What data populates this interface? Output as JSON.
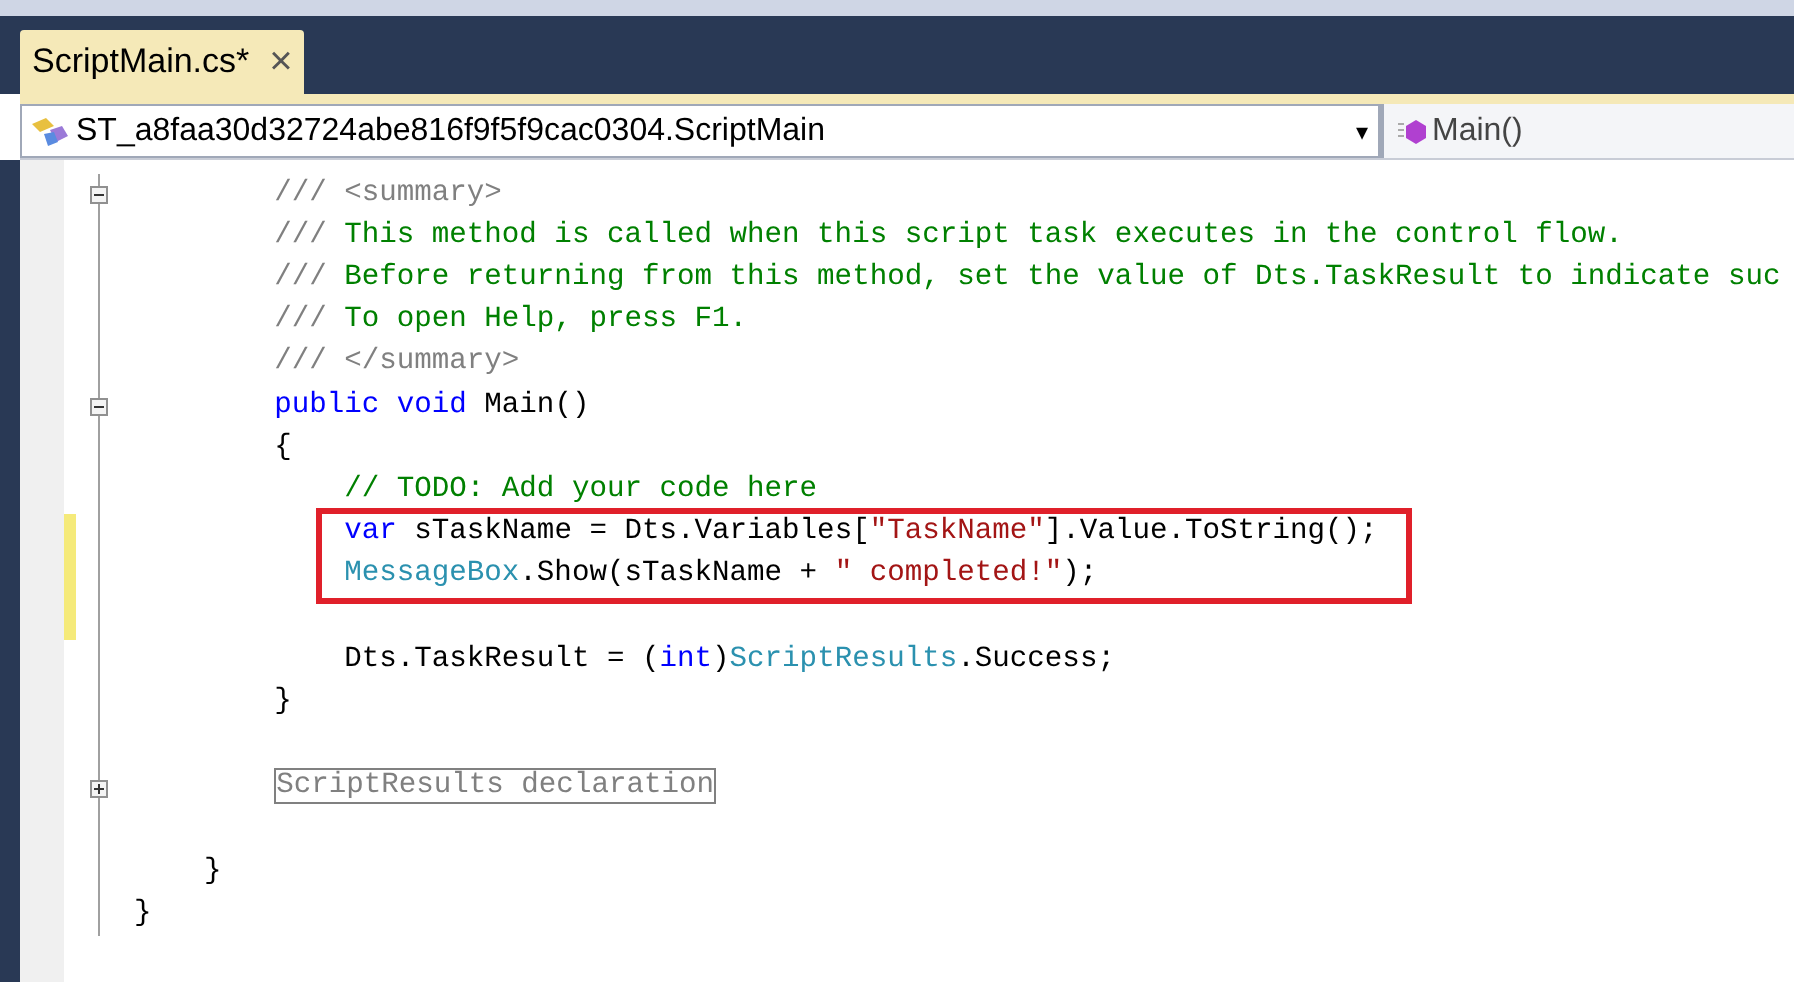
{
  "tabs": [
    {
      "label": "ScriptMain.cs*",
      "close": "×",
      "selected": true
    }
  ],
  "navigation": {
    "type_dropdown": {
      "value": "ST_a8faa30d32724abe816f9f5f9cac0304.ScriptMain",
      "caret": "▾"
    },
    "member_dropdown": {
      "value": "Main()"
    }
  },
  "code_lines": [
    {
      "expanded": true,
      "changed": false,
      "highlighted": false,
      "tokens": [
        {
          "kind": "doc_tag",
          "text": "        /// <summary>"
        }
      ]
    },
    {
      "changed": false,
      "highlighted": false,
      "tokens": [
        {
          "kind": "doc_tag",
          "text": "        /// "
        },
        {
          "kind": "comment",
          "text": "This method is called when this script task executes in the control flow."
        }
      ]
    },
    {
      "changed": false,
      "highlighted": false,
      "tokens": [
        {
          "kind": "doc_tag",
          "text": "        /// "
        },
        {
          "kind": "comment",
          "text": "Before returning from this method, set the value of Dts.TaskResult to indicate suc"
        }
      ]
    },
    {
      "changed": false,
      "highlighted": false,
      "tokens": [
        {
          "kind": "doc_tag",
          "text": "        /// "
        },
        {
          "kind": "comment",
          "text": "To open Help, press F1."
        }
      ]
    },
    {
      "changed": false,
      "highlighted": false,
      "tokens": [
        {
          "kind": "doc_tag",
          "text": "        /// </summary>"
        }
      ]
    },
    {
      "expanded": true,
      "changed": false,
      "highlighted": false,
      "tokens": [
        {
          "kind": "keyword",
          "text": "        public"
        },
        {
          "kind": "keyword",
          "text": " void"
        },
        {
          "kind": "plain",
          "text": " Main()"
        }
      ]
    },
    {
      "changed": false,
      "highlighted": false,
      "tokens": [
        {
          "kind": "plain",
          "text": "        {"
        }
      ]
    },
    {
      "changed": false,
      "highlighted": false,
      "tokens": [
        {
          "kind": "comment",
          "text": "            // TODO: Add your code here"
        }
      ]
    },
    {
      "changed": true,
      "highlighted": true,
      "tokens": [
        {
          "kind": "keyword",
          "text": "            var"
        },
        {
          "kind": "plain",
          "text": " sTaskName = Dts.Variables["
        },
        {
          "kind": "string",
          "text": "\"TaskName\""
        },
        {
          "kind": "plain",
          "text": "].Value.ToString();"
        }
      ]
    },
    {
      "changed": true,
      "highlighted": true,
      "tokens": [
        {
          "kind": "type",
          "text": "            MessageBox"
        },
        {
          "kind": "plain",
          "text": ".Show(sTaskName + "
        },
        {
          "kind": "string",
          "text": "\" completed!\""
        },
        {
          "kind": "plain",
          "text": ");"
        }
      ]
    },
    {
      "changed": true,
      "highlighted": false
    },
    {
      "changed": false,
      "highlighted": false,
      "tokens": [
        {
          "kind": "plain",
          "text": "            Dts.TaskResult = ("
        },
        {
          "kind": "keyword",
          "text": "int"
        },
        {
          "kind": "plain",
          "text": ")"
        },
        {
          "kind": "type",
          "text": "ScriptResults"
        },
        {
          "kind": "plain",
          "text": ".Success;"
        }
      ]
    },
    {
      "changed": false,
      "highlighted": false,
      "tokens": [
        {
          "kind": "plain",
          "text": "        }"
        }
      ]
    },
    {
      "changed": false,
      "highlighted": false
    },
    {
      "expanded": false,
      "changed": false,
      "highlighted": false,
      "tokens": [
        {
          "kind": "region",
          "text": "        ScriptResults declaration"
        }
      ]
    },
    {
      "changed": false,
      "highlighted": false
    },
    {
      "changed": false,
      "highlighted": false,
      "tokens": [
        {
          "kind": "plain",
          "text": "    }"
        }
      ]
    },
    {
      "changed": false,
      "highlighted": false,
      "tokens": [
        {
          "kind": "plain",
          "text": "}"
        }
      ]
    }
  ]
}
